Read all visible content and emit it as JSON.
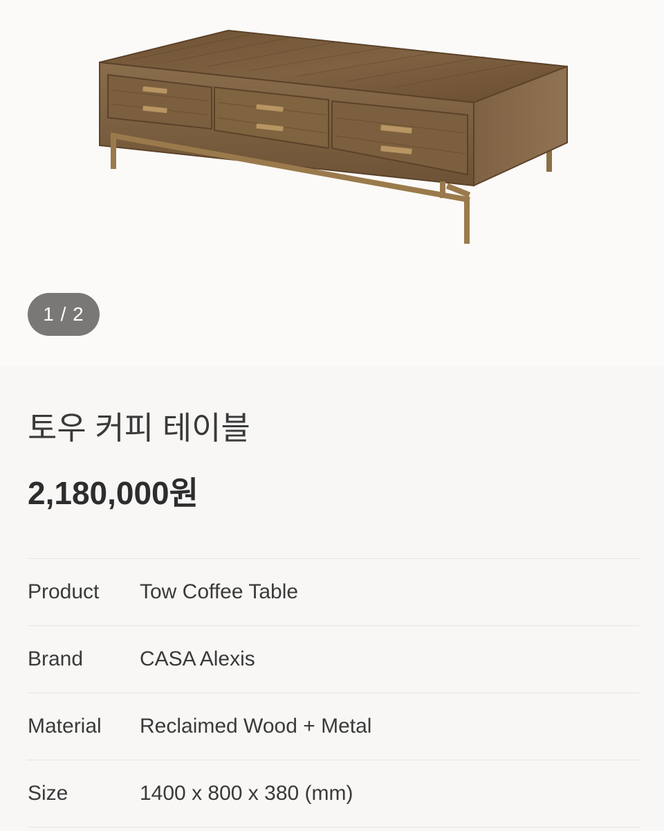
{
  "gallery": {
    "image_alt": "토우 커피 테이블",
    "counter": "1 / 2"
  },
  "product": {
    "name": "토우 커피 테이블",
    "price": "2,180,000원"
  },
  "specs": [
    {
      "key": "Product",
      "value": "Tow Coffee Table"
    },
    {
      "key": "Brand",
      "value": "CASA Alexis"
    },
    {
      "key": "Material",
      "value": "Reclaimed Wood + Metal"
    },
    {
      "key": "Size",
      "value": "1400 x 800 x 380 (mm)"
    }
  ],
  "colors": {
    "wood": "#7a5a3a",
    "metal": "#9a7a4c",
    "counter_bg": "#7a7876"
  }
}
